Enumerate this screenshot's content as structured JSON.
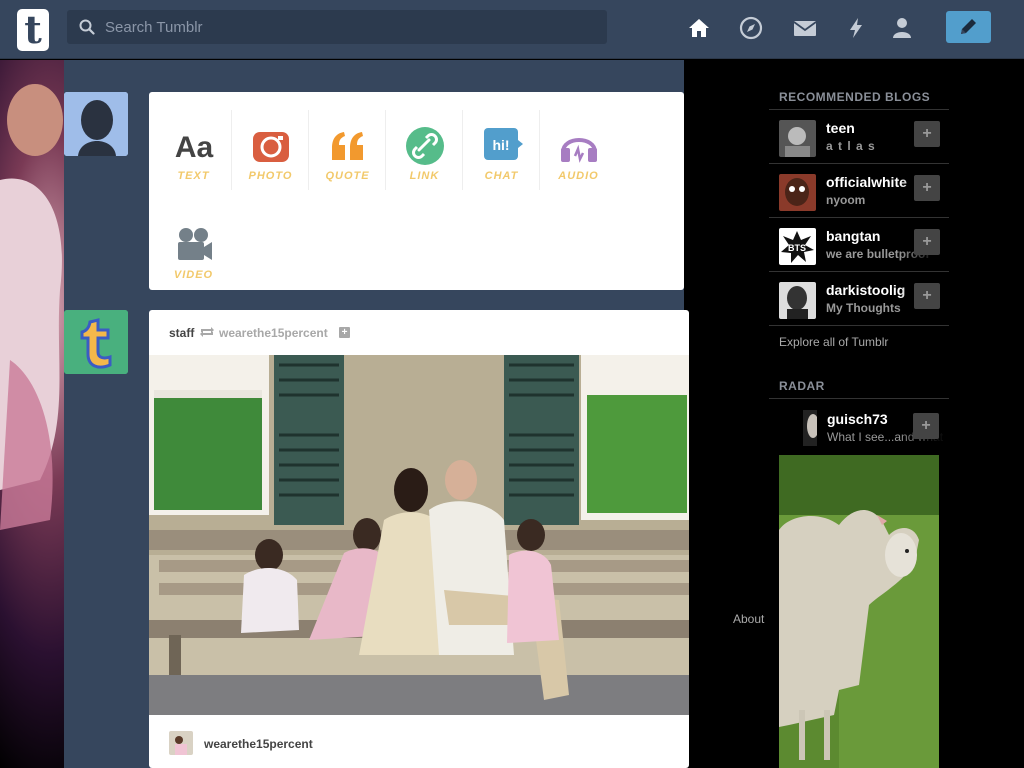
{
  "header": {
    "logo": "t",
    "search_placeholder": "Search Tumblr",
    "icons": [
      "home-icon",
      "explore-compass-icon",
      "inbox-mail-icon",
      "activity-lightning-icon",
      "account-person-icon",
      "compose-pencil-icon"
    ]
  },
  "post_types": [
    {
      "label": "TEXT",
      "icon": "text-aa-icon",
      "color": "#444444",
      "icon_text": "Aa"
    },
    {
      "label": "PHOTO",
      "icon": "photo-camera-icon",
      "color": "#d95e40"
    },
    {
      "label": "QUOTE",
      "icon": "quote-icon",
      "color": "#f2992e"
    },
    {
      "label": "LINK",
      "icon": "link-icon",
      "color": "#56bc8a"
    },
    {
      "label": "CHAT",
      "icon": "chat-bubble-icon",
      "color": "#529ecc",
      "icon_text": "hi!"
    },
    {
      "label": "AUDIO",
      "icon": "headphones-icon",
      "color": "#a77dc2"
    },
    {
      "label": "VIDEO",
      "icon": "video-camera-icon",
      "color": "#748089"
    }
  ],
  "post": {
    "author": "staff",
    "source": "wearethe15percent",
    "follow_symbol": "+",
    "footer_name": "wearethe15percent"
  },
  "sidebar": {
    "recommended_heading": "RECOMMENDED BLOGS",
    "recommended": [
      {
        "name": "teen",
        "sub": "a t l a s",
        "add": "+"
      },
      {
        "name": "officialwhite",
        "sub": "nyoom",
        "add": "+"
      },
      {
        "name": "bangtan",
        "sub": "we are bulletproof",
        "add": "+",
        "avatar_text": "BTS"
      },
      {
        "name": "darkistoolig",
        "sub": "My Thoughts",
        "add": "+"
      }
    ],
    "explore": "Explore all of Tumblr",
    "radar_heading": "RADAR",
    "radar": {
      "name": "guisch73",
      "sub": "What I see...and what",
      "add": "+"
    },
    "about": "About"
  },
  "colors": {
    "navy": "#36465d",
    "accent": "#529ecc",
    "background": "#000000"
  }
}
